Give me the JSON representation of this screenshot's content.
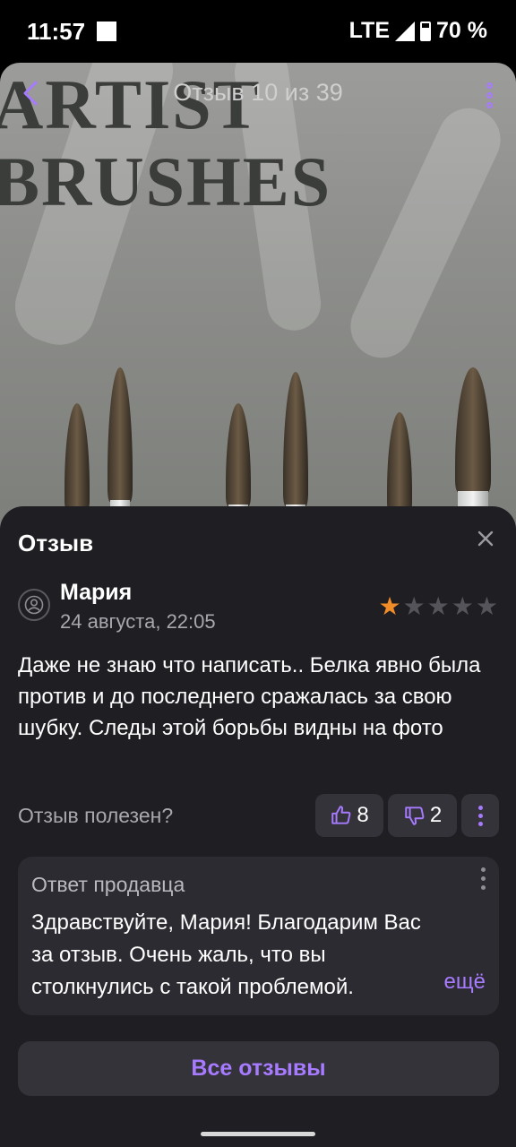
{
  "status_bar": {
    "time": "11:57",
    "network": "LTE",
    "battery": "70 %"
  },
  "photo": {
    "title": "Отзыв 10 из 39",
    "watermark_line1": "ARTIST",
    "watermark_line2": "BRUSHES"
  },
  "sheet": {
    "title": "Отзыв",
    "author": "Мария",
    "date": "24 августа, 22:05",
    "rating": 1,
    "rating_max": 5,
    "review_text": "Даже не знаю что написать..  Белка явно была против и до последнего сражалась за свою шубку.  Следы этой борьбы видны на фото",
    "helpful_label": "Отзыв полезен?",
    "likes": "8",
    "dislikes": "2",
    "seller_reply": {
      "title": "Ответ продавца",
      "text": "Здравствуйте, Мария! Благодарим Вас за отзыв. Очень жаль, что вы столкнулись с такой проблемой.",
      "more_label": "ещё"
    },
    "all_reviews_label": "Все отзывы"
  },
  "colors": {
    "accent": "#a77bff",
    "star_active": "#f28c28",
    "star_inactive": "#55545a",
    "sheet_bg": "#1f1e23"
  },
  "icons": [
    "back-chevron-icon",
    "more-vertical-icon",
    "close-icon",
    "user-icon",
    "thumbs-up-icon",
    "thumbs-down-icon",
    "star-icon"
  ]
}
